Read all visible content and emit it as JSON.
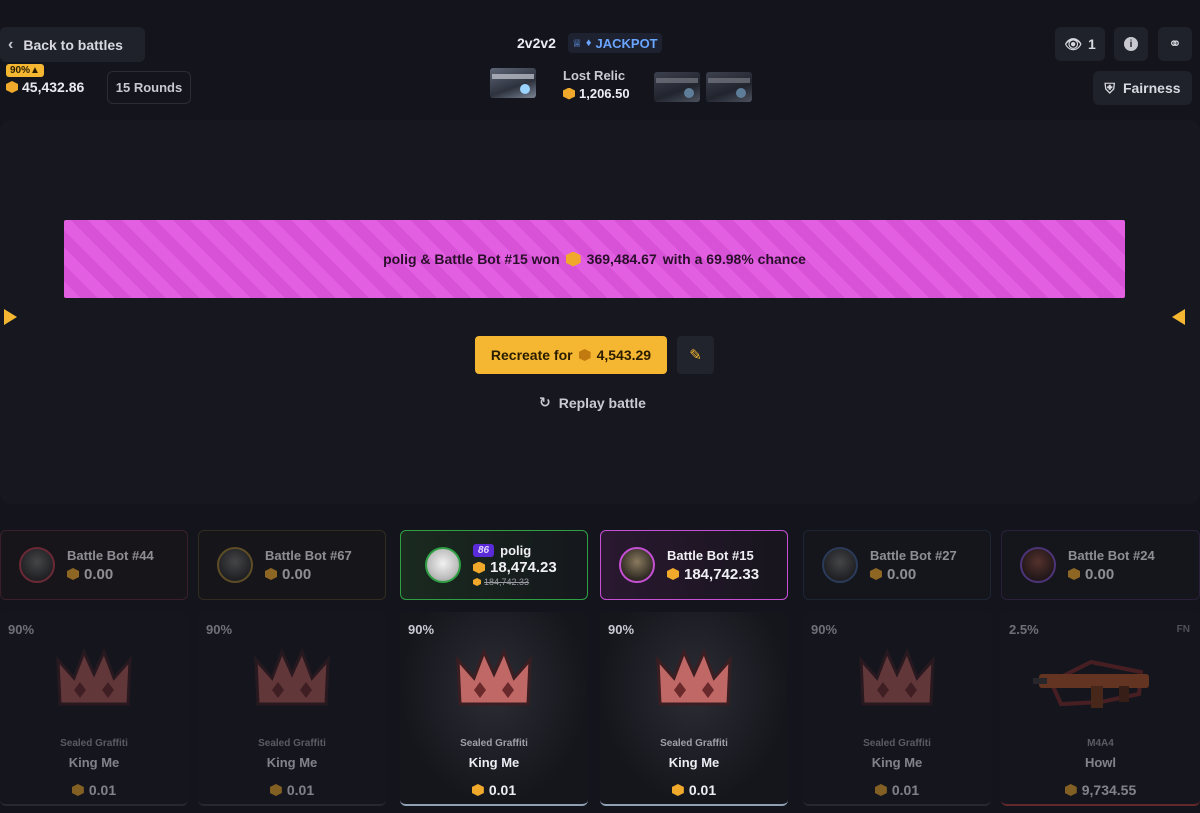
{
  "header": {
    "back_label": "Back to battles",
    "chance_badge": "90%",
    "total_value": "45,432.86",
    "rounds_label": "15 Rounds",
    "mode": "2v2v2",
    "mode_tag": "JACKPOT",
    "case_name": "Lost Relic",
    "case_price": "1,206.50",
    "viewers": "1",
    "fairness_label": "Fairness",
    "icons": [
      "chevron-left-icon",
      "crown-icon",
      "trophy-icon",
      "eye-icon",
      "info-icon",
      "link-icon",
      "shield-icon"
    ]
  },
  "arena": {
    "win_text_prefix": "polig & Battle Bot #15 won",
    "win_amount": "369,484.67",
    "win_text_suffix": "with a 69.98% chance",
    "banner_color": "#e055e0",
    "recreate_label": "Recreate for",
    "recreate_price": "4,543.29",
    "replay_label": "Replay battle"
  },
  "players": [
    {
      "name": "Battle Bot #44",
      "value": "0.00",
      "color": "#5a2a34"
    },
    {
      "name": "Battle Bot #67",
      "value": "0.00",
      "color": "#4a3f22"
    },
    {
      "name": "polig",
      "value": "18,474.23",
      "strike": "184,742.33",
      "level": "86",
      "color": "#2ea043"
    },
    {
      "name": "Battle Bot #15",
      "value": "184,742.33",
      "color": "#c64fd6"
    },
    {
      "name": "Battle Bot #27",
      "value": "0.00",
      "color": "#26334a"
    },
    {
      "name": "Battle Bot #24",
      "value": "0.00",
      "color": "#3d2a55"
    }
  ],
  "items": [
    {
      "chance": "90%",
      "category": "Sealed Graffiti",
      "name": "King Me",
      "price": "0.01",
      "wear": ""
    },
    {
      "chance": "90%",
      "category": "Sealed Graffiti",
      "name": "King Me",
      "price": "0.01",
      "wear": ""
    },
    {
      "chance": "90%",
      "category": "Sealed Graffiti",
      "name": "King Me",
      "price": "0.01",
      "wear": ""
    },
    {
      "chance": "90%",
      "category": "Sealed Graffiti",
      "name": "King Me",
      "price": "0.01",
      "wear": ""
    },
    {
      "chance": "90%",
      "category": "Sealed Graffiti",
      "name": "King Me",
      "price": "0.01",
      "wear": ""
    },
    {
      "chance": "2.5%",
      "category": "M4A4",
      "name": "Howl",
      "price": "9,734.55",
      "wear": "FN"
    }
  ],
  "colors": {
    "accent": "#f5b731",
    "coin": "#f0a92b",
    "background": "#14151c"
  }
}
